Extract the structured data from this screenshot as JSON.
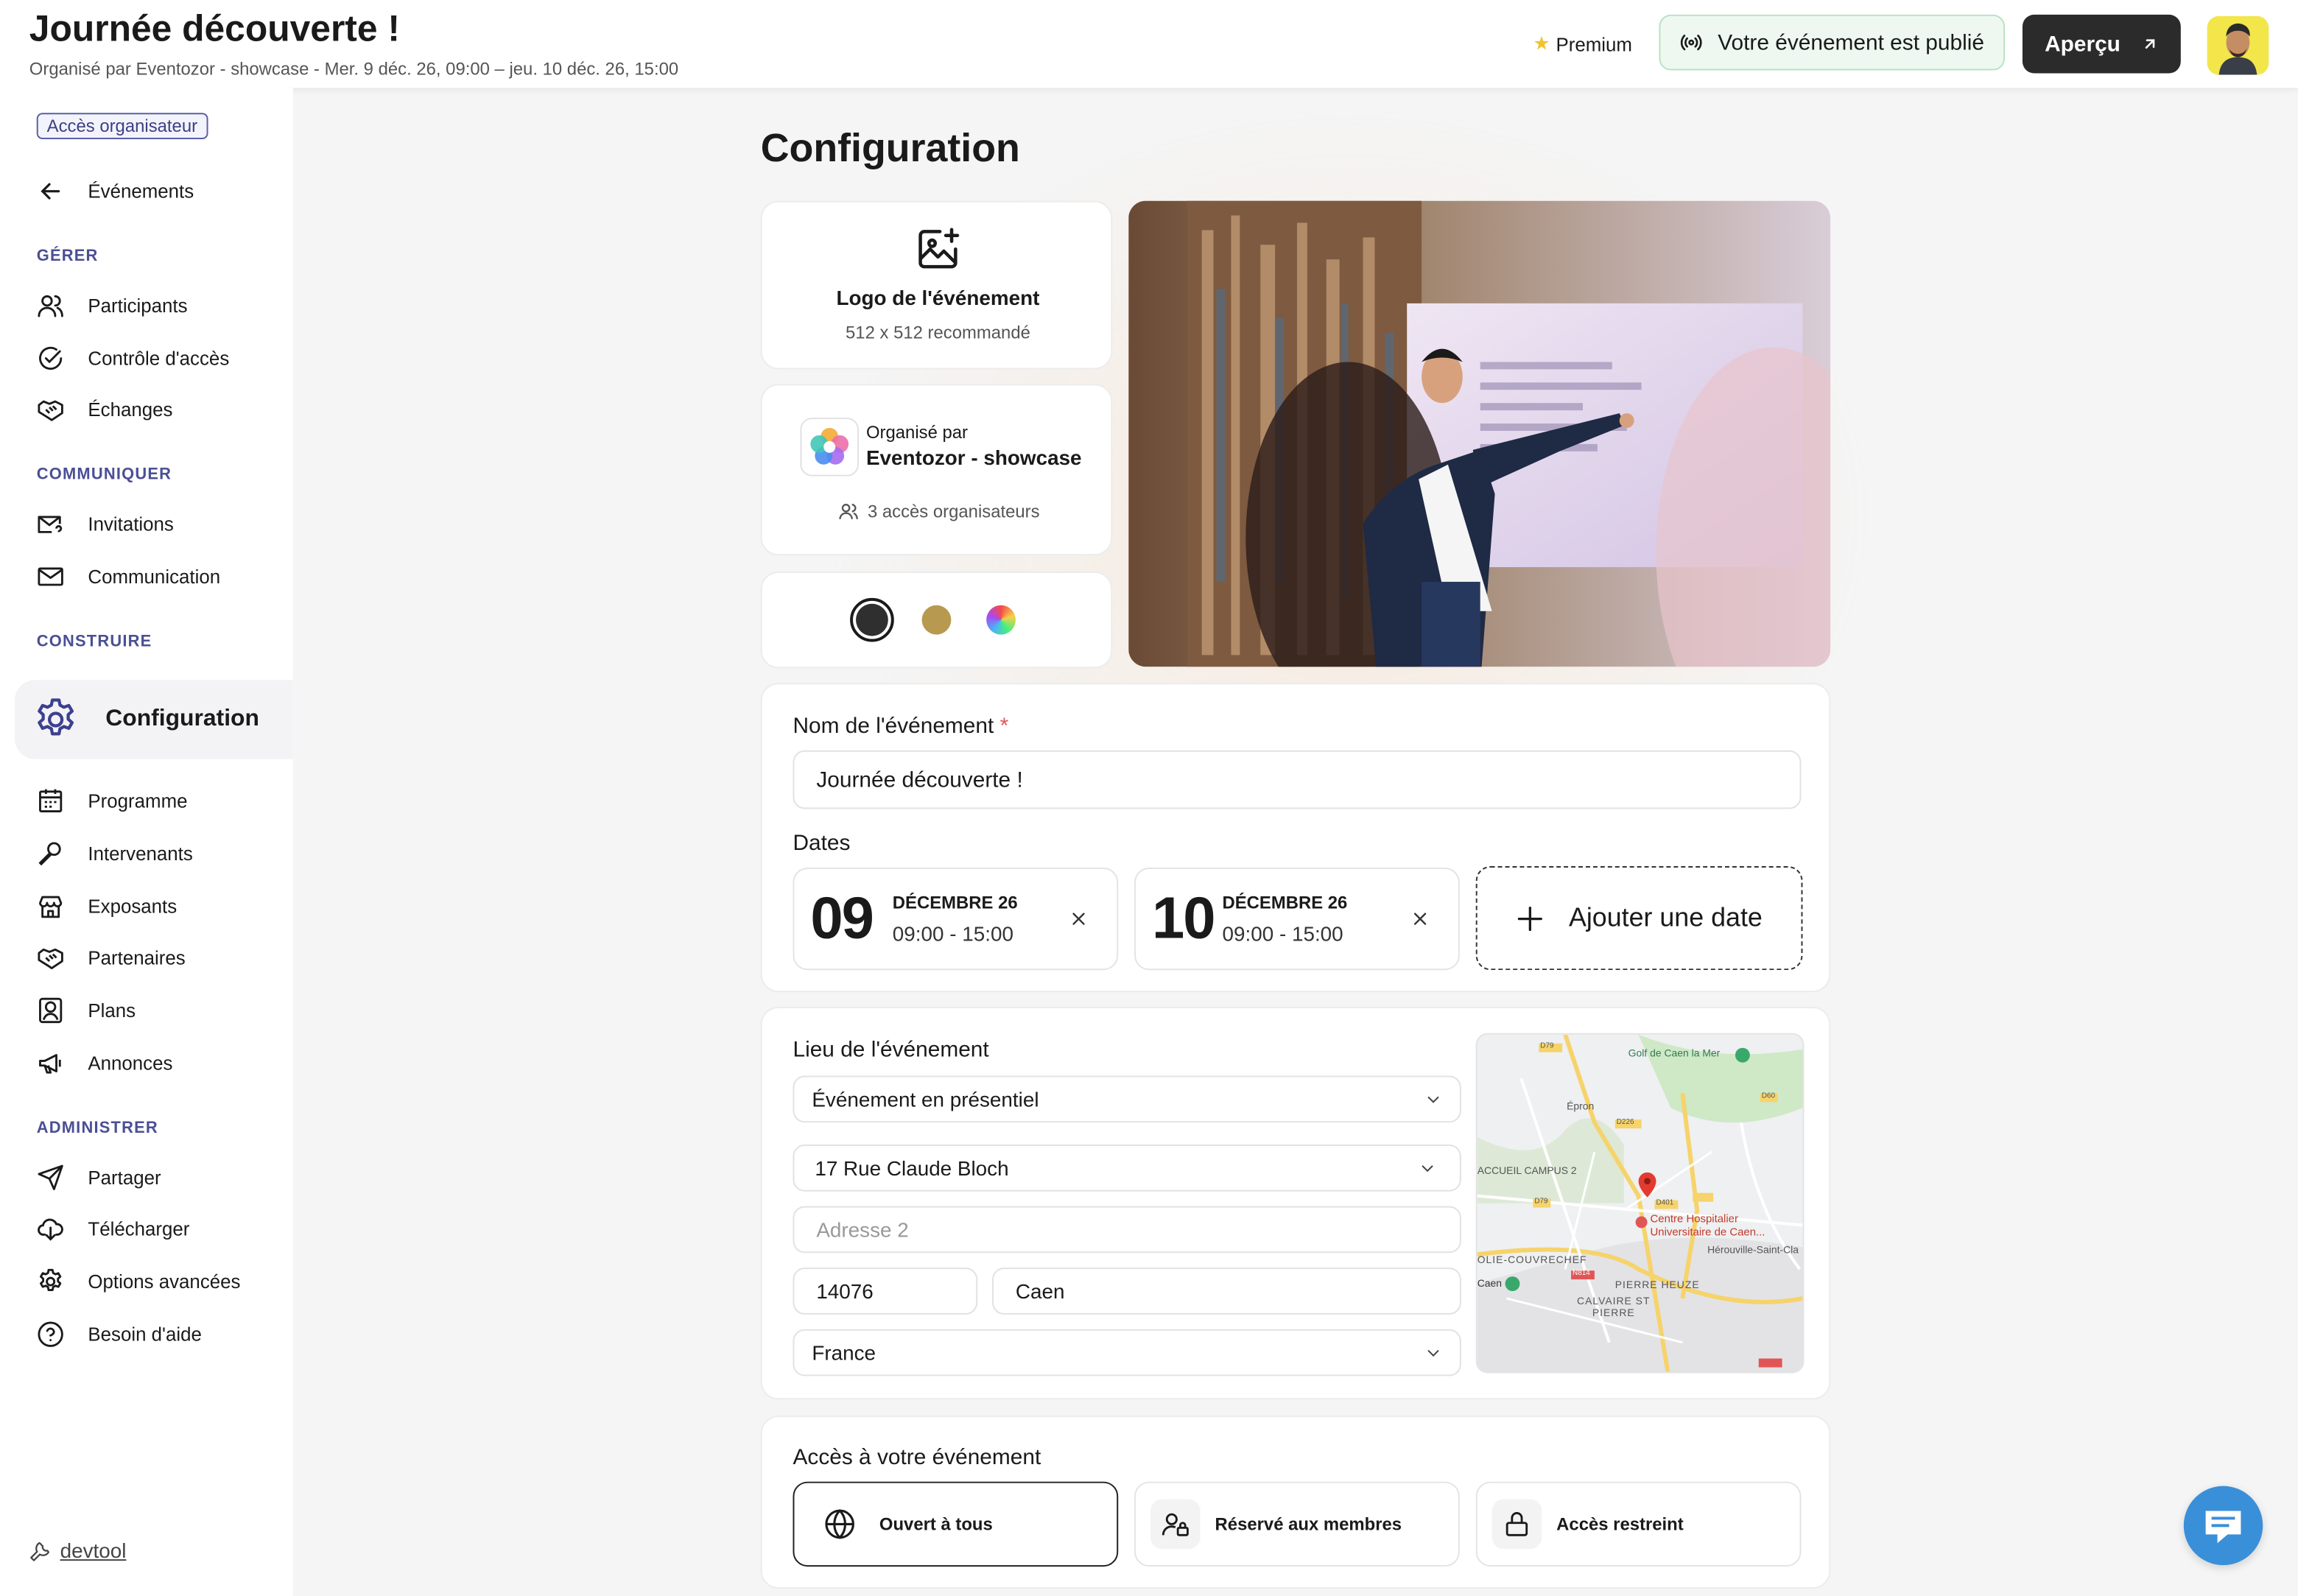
{
  "header": {
    "title": "Journée découverte !",
    "subtitle": "Organisé par Eventozor - showcase - Mer. 9 déc. 26, 09:00 – jeu. 10 déc. 26, 15:00",
    "premium_label": "Premium",
    "published_label": "Votre événement est publié",
    "preview_label": "Aperçu"
  },
  "sidebar": {
    "badge": "Accès organisateur",
    "back_label": "Événements",
    "sections": {
      "manage": "GÉRER",
      "communicate": "COMMUNIQUER",
      "build": "CONSTRUIRE",
      "admin": "ADMINISTRER"
    },
    "items": {
      "participants": "Participants",
      "access_control": "Contrôle d'accès",
      "exchanges": "Échanges",
      "invitations": "Invitations",
      "communication": "Communication",
      "configuration": "Configuration",
      "program": "Programme",
      "speakers": "Intervenants",
      "exhibitors": "Exposants",
      "partners": "Partenaires",
      "plans": "Plans",
      "announcements": "Annonces",
      "share": "Partager",
      "download": "Télécharger",
      "advanced": "Options avancées",
      "help": "Besoin d'aide"
    },
    "devtool": "devtool"
  },
  "main": {
    "title": "Configuration",
    "logo_card": {
      "title": "Logo de l'événement",
      "hint": "512 x 512 recommandé"
    },
    "org_card": {
      "prefix": "Organisé par",
      "name": "Eventozor - showcase",
      "access_count": "3 accès organisateurs"
    },
    "colors": {
      "dark": "#2f2f2f",
      "gold": "#b79a4f"
    },
    "event_name": {
      "label": "Nom de l'événement",
      "required": "*",
      "value": "Journée découverte !"
    },
    "dates": {
      "label": "Dates",
      "items": [
        {
          "day": "09",
          "month": "DÉCEMBRE 26",
          "hours": "09:00 - 15:00"
        },
        {
          "day": "10",
          "month": "DÉCEMBRE 26",
          "hours": "09:00 - 15:00"
        }
      ],
      "add_label": "Ajouter une date"
    },
    "location": {
      "label": "Lieu de l'événement",
      "type": "Événement en présentiel",
      "address1": "17 Rue Claude Bloch",
      "address2_placeholder": "Adresse 2",
      "zip": "14076",
      "city": "Caen",
      "country": "France",
      "map_labels": {
        "golf": "Golf de Caen la Mer",
        "epron": "Épron",
        "campus": "ACCUEIL CAMPUS 2",
        "hospital": "Centre Hospitalier Universitaire de Caen...",
        "herouville": "Hérouville-Saint-Cla",
        "folie": "OLIE-COUVRECHEF",
        "caen": "Caen",
        "pierre_heuze": "PIERRE HEUZE",
        "calvaire": "CALVAIRE ST PIERRE",
        "d60": "D60",
        "d7": "D79",
        "d2": "D226",
        "d401": "D401",
        "d79": "D79",
        "n814": "N814"
      }
    },
    "access": {
      "label": "Accès à votre événement",
      "options": [
        "Ouvert à tous",
        "Réservé aux membres",
        "Accès restreint"
      ]
    }
  }
}
